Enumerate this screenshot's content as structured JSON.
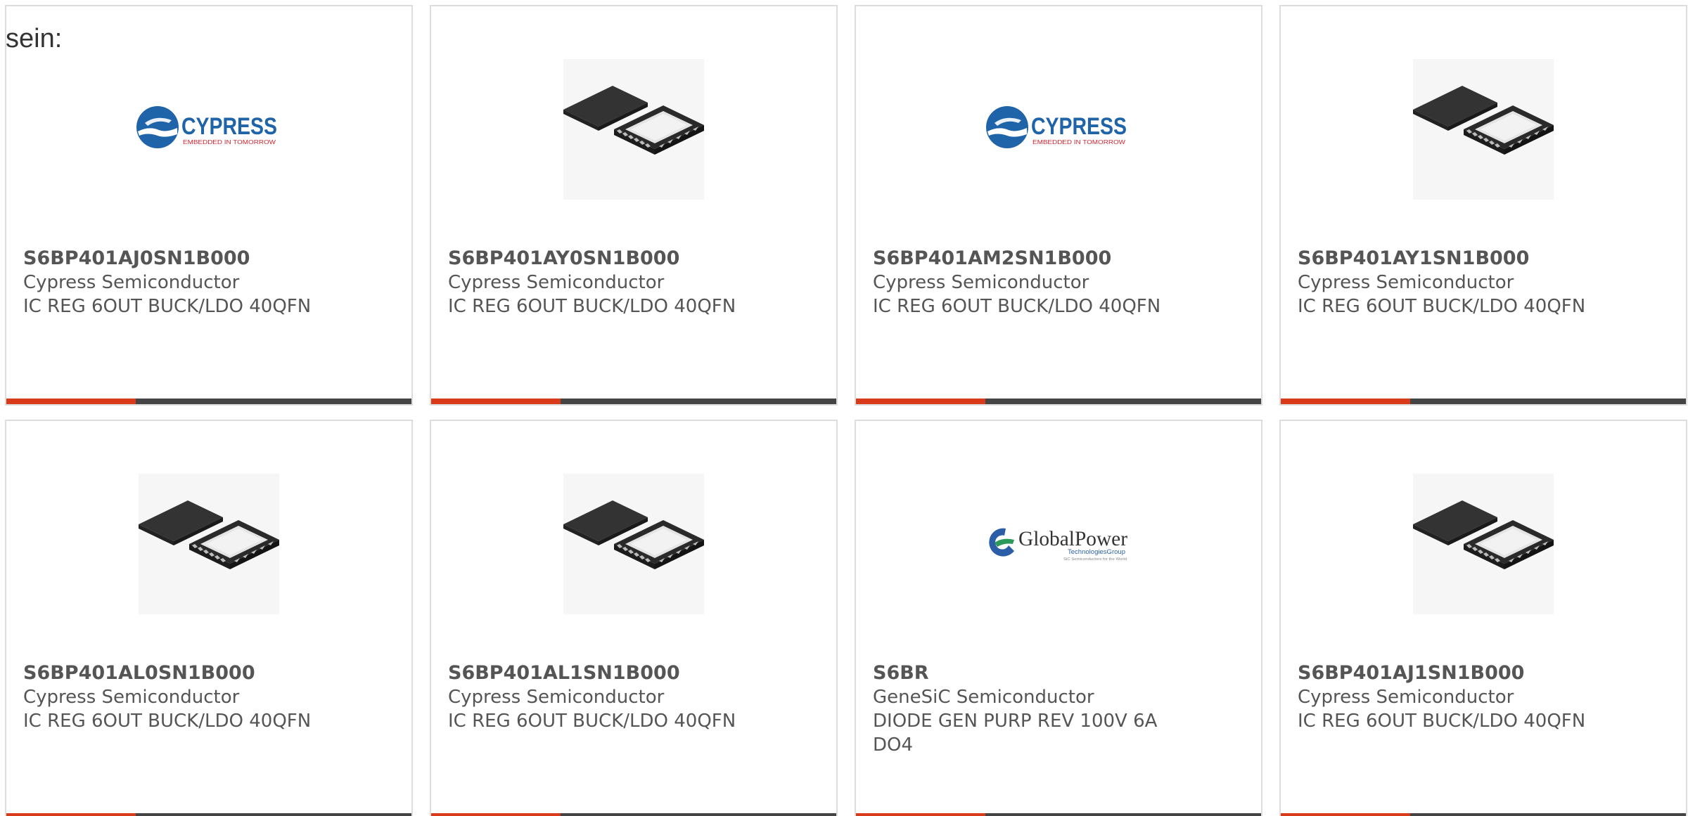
{
  "intro_text": "sein:",
  "colors": {
    "bar_accent": "#d83a1a",
    "bar_dark": "#444444",
    "card_border": "#dddddd",
    "text": "#555555",
    "cypress_blue": "#1f63a9",
    "cypress_red": "#d22530",
    "gp_blue": "#2c5ea8",
    "gp_green": "#2c9a58"
  },
  "logos": {
    "cypress": {
      "name": "CYPRESS",
      "tagline": "EMBEDDED IN TOMORROW"
    },
    "globalpower": {
      "name": "GlobalPower",
      "sub": "TechnologiesGroup",
      "tagline": "SiC Semiconductors for the World"
    }
  },
  "cards": [
    {
      "part": "S6BP401AJ0SN1B000",
      "manufacturer": "Cypress Semiconductor",
      "description": "IC REG 6OUT BUCK/LDO 40QFN",
      "image": "cypress-logo"
    },
    {
      "part": "S6BP401AY0SN1B000",
      "manufacturer": "Cypress Semiconductor",
      "description": "IC REG 6OUT BUCK/LDO 40QFN",
      "image": "qfn-chip"
    },
    {
      "part": "S6BP401AM2SN1B000",
      "manufacturer": "Cypress Semiconductor",
      "description": "IC REG 6OUT BUCK/LDO 40QFN",
      "image": "cypress-logo"
    },
    {
      "part": "S6BP401AY1SN1B000",
      "manufacturer": "Cypress Semiconductor",
      "description": "IC REG 6OUT BUCK/LDO 40QFN",
      "image": "qfn-chip"
    },
    {
      "part": "S6BP401AL0SN1B000",
      "manufacturer": "Cypress Semiconductor",
      "description": "IC REG 6OUT BUCK/LDO 40QFN",
      "image": "qfn-chip"
    },
    {
      "part": "S6BP401AL1SN1B000",
      "manufacturer": "Cypress Semiconductor",
      "description": "IC REG 6OUT BUCK/LDO 40QFN",
      "image": "qfn-chip"
    },
    {
      "part": "S6BR",
      "manufacturer": "GeneSiC Semiconductor",
      "description": "DIODE GEN PURP REV 100V 6A DO4",
      "image": "globalpower-logo"
    },
    {
      "part": "S6BP401AJ1SN1B000",
      "manufacturer": "Cypress Semiconductor",
      "description": "IC REG 6OUT BUCK/LDO 40QFN",
      "image": "qfn-chip"
    }
  ]
}
